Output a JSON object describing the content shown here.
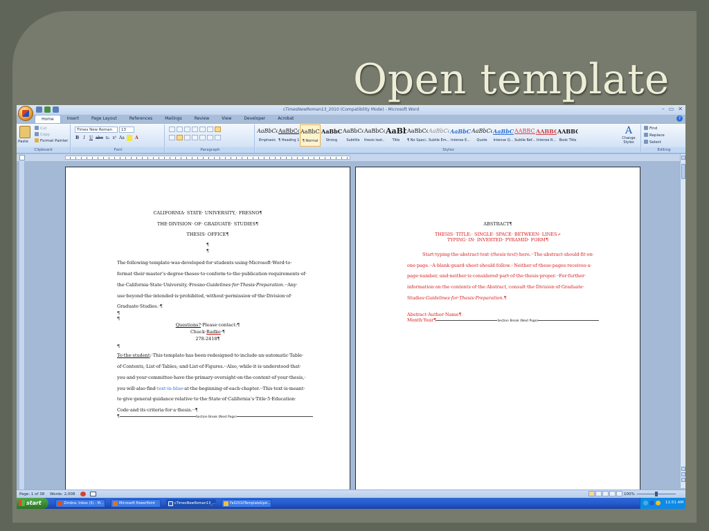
{
  "slide": {
    "title": "Open template"
  },
  "window": {
    "title": "cTimesNewRoman13_2010 (Compatibility Mode) - Microsoft Word",
    "controls": [
      "–",
      "▭",
      "✕"
    ]
  },
  "ribbon": {
    "tabs": [
      "Home",
      "Insert",
      "Page Layout",
      "References",
      "Mailings",
      "Review",
      "View",
      "Developer",
      "Acrobat"
    ],
    "clipboard": {
      "paste": "Paste",
      "cut": "Cut",
      "copy": "Copy",
      "format_painter": "Format Painter",
      "label": "Clipboard"
    },
    "font": {
      "name": "Times New Roman",
      "size": "13",
      "label": "Font",
      "buttons": [
        "B",
        "I",
        "U",
        "abe",
        "x₂",
        "x²",
        "Aa"
      ]
    },
    "paragraph": {
      "label": "Paragraph"
    },
    "styles": {
      "label": "Styles",
      "tiles": [
        {
          "sample": "AaBbCcI",
          "name": "Emphasis",
          "color": "#1a1a1a",
          "italic": true
        },
        {
          "sample": "AaBbCcI",
          "name": "¶ Heading 1",
          "color": "#1a1a1a",
          "underline": true
        },
        {
          "sample": "AaBbCcI",
          "name": "¶ Normal",
          "color": "#1a1a1a",
          "selected": true
        },
        {
          "sample": "AaBbCc",
          "name": "Strong",
          "color": "#1a1a1a",
          "bold": true
        },
        {
          "sample": "AaBbCcI",
          "name": "Subtitle",
          "color": "#1a1a1a"
        },
        {
          "sample": "AaBbCcI",
          "name": "thesis text...",
          "color": "#1a1a1a"
        },
        {
          "sample": "AaBb(",
          "name": "Title",
          "color": "#1a1a1a",
          "bold": true,
          "big": true
        },
        {
          "sample": "AaBbCcI",
          "name": "¶ No Spaci...",
          "color": "#1a1a1a"
        },
        {
          "sample": "AaBbCcI",
          "name": "Subtle Em...",
          "color": "#8a8a8a",
          "italic": true
        },
        {
          "sample": "AaBbCcI",
          "name": "Intense E...",
          "color": "#2e6fd0",
          "italic": true,
          "bold": true
        },
        {
          "sample": "AaBbCcI",
          "name": "Quote",
          "color": "#1a1a1a",
          "italic": true
        },
        {
          "sample": "AaBbCcI",
          "name": "Intense Q...",
          "color": "#2e6fd0",
          "italic": true,
          "bold": true,
          "underline": true
        },
        {
          "sample": "AABBCC",
          "name": "Subtle Ref...",
          "color": "#d04040",
          "underline": true
        },
        {
          "sample": "AABBCCI",
          "name": "Intense R...",
          "color": "#d04040",
          "bold": true,
          "underline": true
        },
        {
          "sample": "AABBCCI",
          "name": "Book Title",
          "color": "#1a1a1a",
          "bold": true
        }
      ],
      "change_styles": "Change Styles"
    },
    "editing": {
      "find": "Find",
      "replace": "Replace",
      "select": "Select",
      "label": "Editing"
    }
  },
  "document": {
    "left_page": {
      "header": [
        "CALIFORNIA· STATE· UNIVERSITY,· FRESNO¶",
        "THE·DIVISION· OF· GRADUATE· STUDIES¶",
        "THESIS· OFFICE¶"
      ],
      "pilcrows_top": [
        "¶",
        "¶"
      ],
      "intro_lines": [
        "The·following·template·was·developed·for·students·using·Microsoft·Word·to·",
        "format·their·master’s·degree·theses·to·conform·to·the·publication·requirements·of·",
        "the·California·State·University,·Fresno·",
        "use·beyond·the·intended·is·prohibited,·without·permission·of·the·Division·of·",
        "Graduate·Studies.·¶"
      ],
      "intro_italic": "Guidelines·for·Thesis·Preparation.",
      "intro_tail": "··Any·",
      "pilcrows_mid": [
        "¶",
        "¶"
      ],
      "contact": {
        "questions": "Questions?",
        "rest": "·Please·contact:¶",
        "name_a": "Chuck·",
        "name_b": "Radke",
        "name_c": "·¶",
        "phone": "278-2418¶"
      },
      "pilcrow_after_contact": "¶",
      "student_lead": "To·the·student",
      "student_lines": [
        ":·This·template·has·been·redesigned·to·include·an·automatic·Table·",
        "of·Contents,·List·of·Tables,·and·List·of·Figures.··Also,·while·it·is·understood·that·",
        "you·and·your·committee·have·the·primary·oversight·on·the·content·of·your·thesis,·",
        "you·will·also·find·",
        "·at·the·beginning·of·each·chapter.··This·text·is·meant·",
        "to·give·general·guidance·relative·to·the·State·of·California’s·Title·5·Education·",
        "Code·and·its·criteria·for·a·thesis.··¶"
      ],
      "blue_text": "text·in·blue",
      "section_break": "Section Break (Next Page)",
      "section_mark": "¶"
    },
    "right_page": {
      "heading": "ABSTRACT¶",
      "thesis_title_1": "THESIS· TITLE:· SINGLE· SPACE· BETWEEN· LINES↵",
      "thesis_title_2": "TYPING· IN· INVERTED· PYRAMID· FORM¶",
      "abstract_first_a": "Start·typing·the·abstract·text·(",
      "abstract_first_italic": "thesis·text",
      "abstract_first_b": ")·here.··The·abstract·should·fit·on·",
      "abstract_lines": [
        "one·page.··A·blank·guard·sheet·should·follow.··Neither·of·these·pages·receives·a·",
        "page·number,·and·neither·is·considered·part·of·the·thesis·proper.··For·further·",
        "information·on·the·contents·of·the·Abstract,·consult·the·Division·of·Graduate·"
      ],
      "abstract_last_a": "Studies·",
      "abstract_last_italic": "Guidelines·for·Thesis·Preparation.",
      "abstract_last_b": "¶",
      "author": "Abstract·Author·Name¶",
      "month_year": "Month·Year¶",
      "section_break": "Section Break (Next Page)"
    }
  },
  "statusbar": {
    "page": "Page: 1 of 38",
    "words": "Words: 2,008",
    "zoom": "100%"
  },
  "taskbar": {
    "start": "start",
    "items": [
      {
        "label": "Zimbra: Inbox (5) - M...",
        "color": "#e05020"
      },
      {
        "label": "Microsoft PowerPoint",
        "color": "#e07030"
      },
      {
        "label": "cTimesNewRoman13_...",
        "color": "#3060c0"
      },
      {
        "label": "Fall2010TemplateUpd...",
        "color": "#f0c040"
      }
    ],
    "clock": "11:51 AM"
  },
  "colors": {
    "slide_bg": "#767b6d",
    "title": "#eeeed8",
    "accent_red": "#d81818",
    "accent_blue": "#2e6fd0"
  }
}
